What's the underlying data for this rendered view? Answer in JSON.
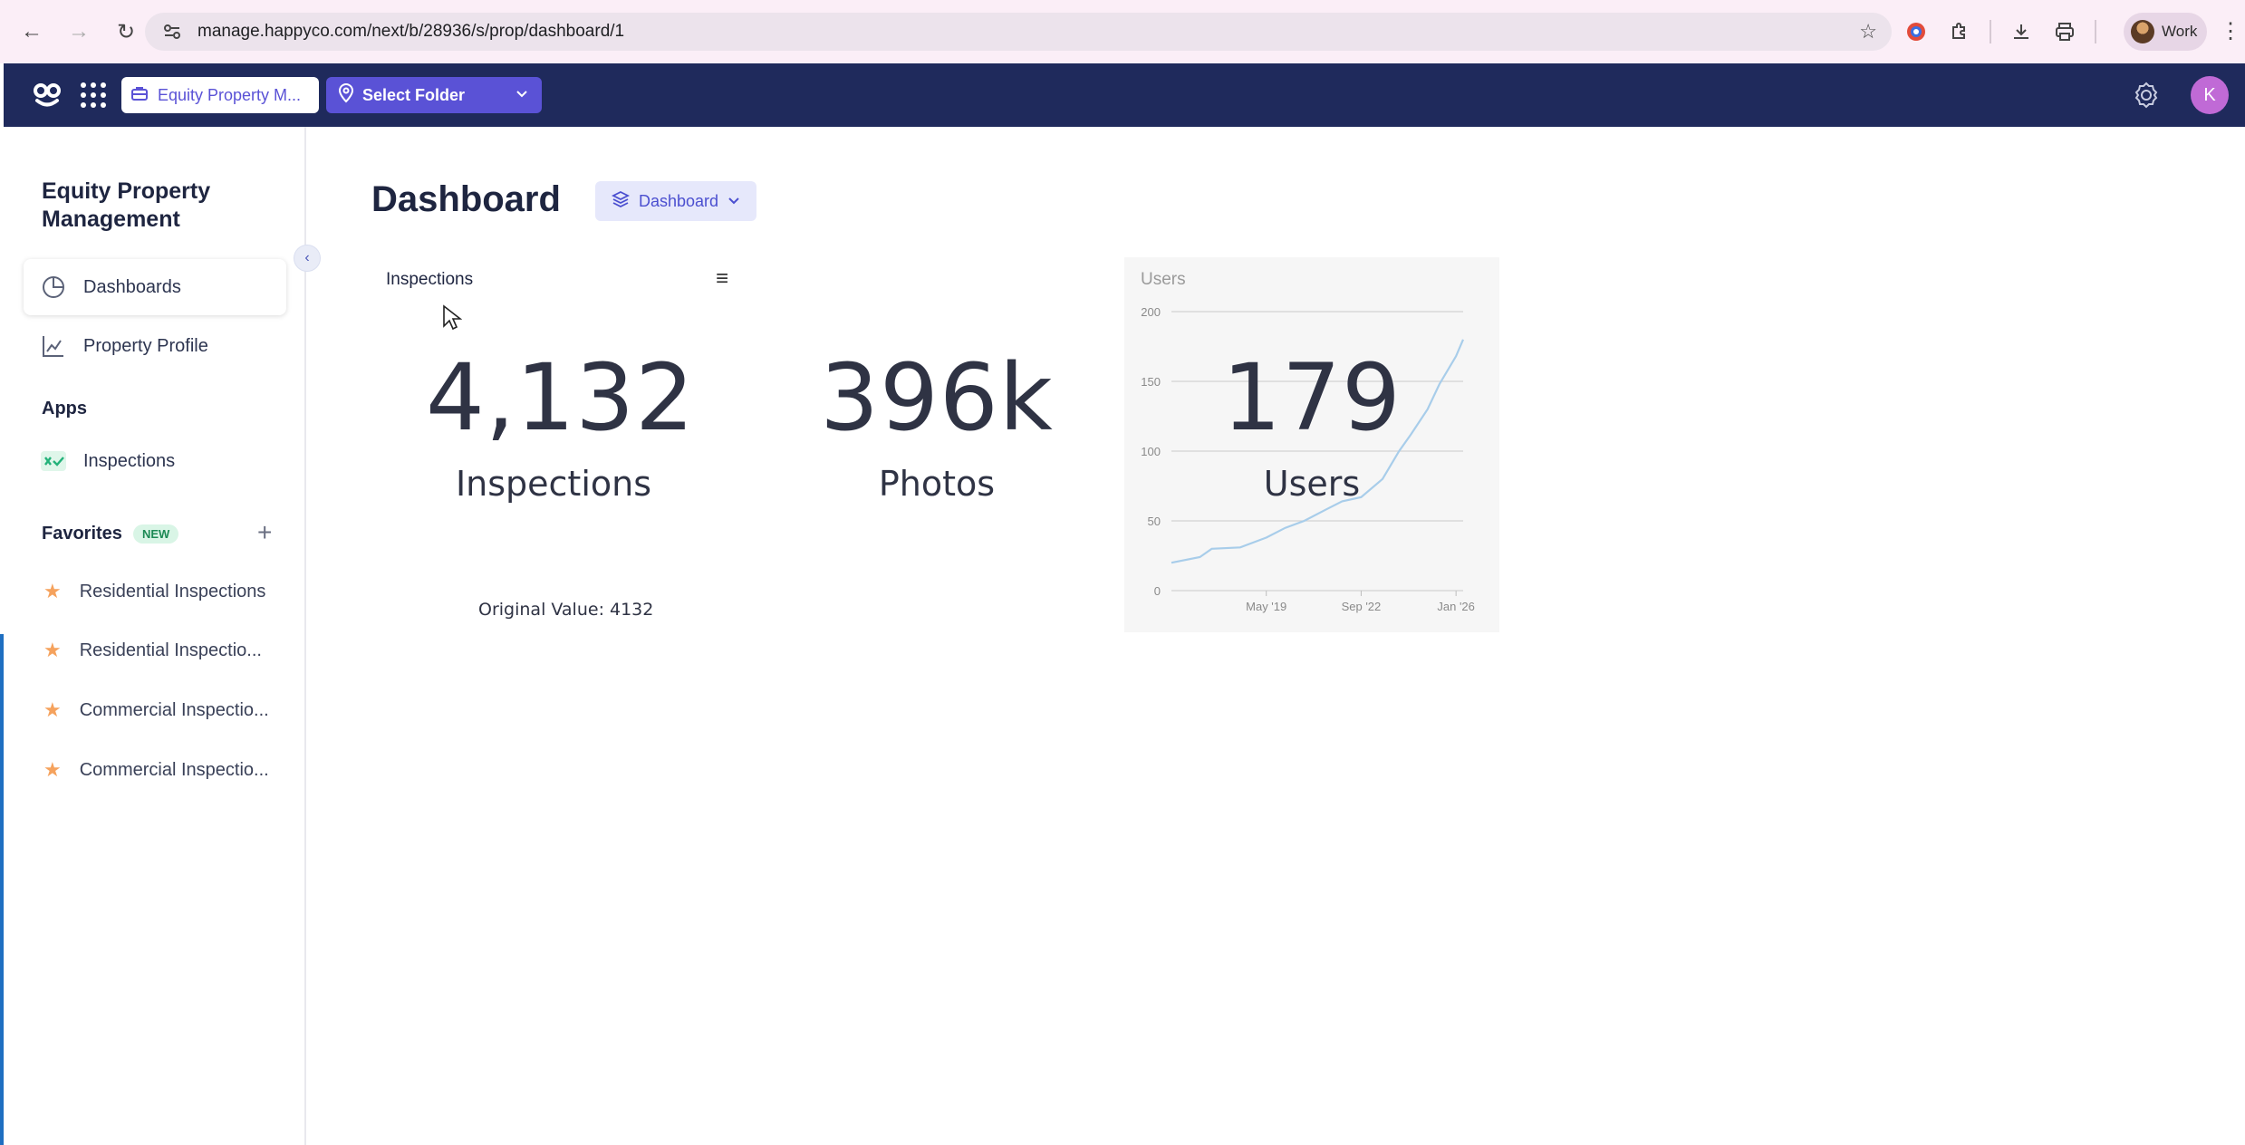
{
  "browser": {
    "url": "manage.happyco.com/next/b/28936/s/prop/dashboard/1",
    "profile_label": "Work"
  },
  "header": {
    "org_chip": "Equity Property M...",
    "folder_select": "Select Folder",
    "avatar_initial": "K"
  },
  "sidebar": {
    "org_name": "Equity Property Management",
    "nav": [
      {
        "label": "Dashboards",
        "icon": "pie-chart-icon",
        "active": true
      },
      {
        "label": "Property Profile",
        "icon": "line-chart-icon"
      }
    ],
    "apps_title": "Apps",
    "apps": [
      {
        "label": "Inspections",
        "icon": "inspections-app-icon"
      }
    ],
    "favorites_title": "Favorites",
    "favorites_badge": "NEW",
    "favorites": [
      {
        "label": "Residential Inspections"
      },
      {
        "label": "Residential Inspectio..."
      },
      {
        "label": "Commercial Inspectio..."
      },
      {
        "label": "Commercial Inspectio..."
      }
    ]
  },
  "main": {
    "title": "Dashboard",
    "dashboard_select": "Dashboard",
    "widgets": {
      "inspections_title": "Inspections",
      "inspections_value": "4,132",
      "inspections_label": "Inspections",
      "inspections_original": "Original Value: 4132",
      "photos_value": "396k",
      "photos_label": "Photos",
      "users_title": "Users",
      "users_value": "179",
      "users_label": "Users"
    }
  },
  "chart_data": {
    "type": "line",
    "title": "Users",
    "x_tick_labels": [
      "May '19",
      "Sep '22",
      "Jan '26"
    ],
    "y_ticks": [
      0,
      50,
      100,
      150,
      200
    ],
    "ylim": [
      0,
      200
    ],
    "grid": true,
    "line_color": "#a8cdea",
    "series": [
      {
        "x": [
          "2016-01",
          "2017-01",
          "2017-06",
          "2018-06",
          "2019-05",
          "2020-01",
          "2020-09",
          "2021-06",
          "2022-01",
          "2022-09",
          "2023-06",
          "2024-01",
          "2024-06",
          "2025-01",
          "2025-06",
          "2026-01",
          "2026-04"
        ],
        "values": [
          20,
          24,
          30,
          31,
          38,
          45,
          50,
          58,
          64,
          67,
          80,
          100,
          112,
          130,
          148,
          168,
          180
        ]
      }
    ]
  }
}
